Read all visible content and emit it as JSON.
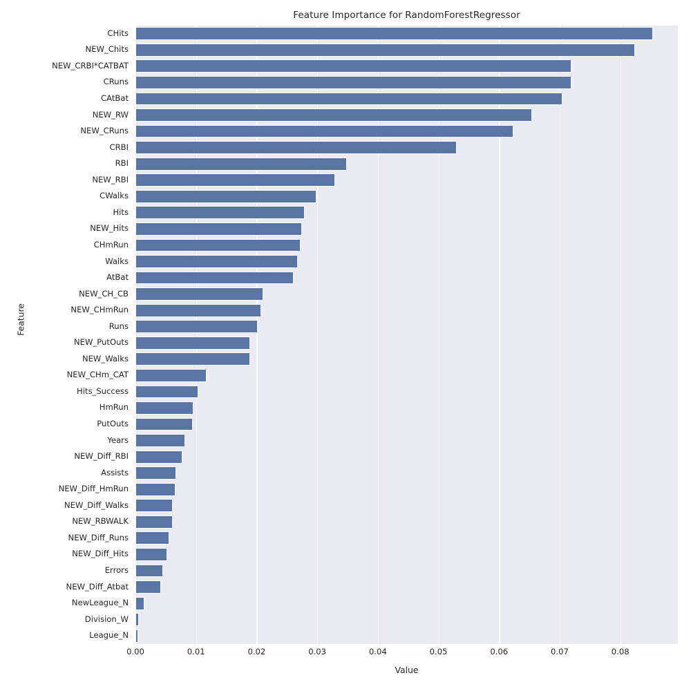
{
  "chart_data": {
    "type": "bar",
    "orientation": "horizontal",
    "title": "Feature Importance for RandomForestRegressor",
    "xlabel": "Value",
    "ylabel": "Feature",
    "xlim": [
      0.0,
      0.0895
    ],
    "xticks": [
      0.0,
      0.01,
      0.02,
      0.03,
      0.04,
      0.05,
      0.06,
      0.07,
      0.08
    ],
    "xticklabels": [
      "0.00",
      "0.01",
      "0.02",
      "0.03",
      "0.04",
      "0.05",
      "0.06",
      "0.07",
      "0.08"
    ],
    "grid": true,
    "legend": null,
    "bar_color": "#5875a3",
    "plot_background": "#eaeaf2",
    "figure_background": "#ffffff",
    "grid_color": "#ffffff",
    "categories": [
      "CHits",
      "NEW_Chits",
      "NEW_CRBI*CATBAT",
      "CRuns",
      "CAtBat",
      "NEW_RW",
      "NEW_CRuns",
      "CRBI",
      "RBI",
      "NEW_RBI",
      "CWalks",
      "Hits",
      "NEW_Hits",
      "CHmRun",
      "Walks",
      "AtBat",
      "NEW_CH_CB",
      "NEW_CHmRun",
      "Runs",
      "NEW_PutOuts",
      "NEW_Walks",
      "NEW_CHm_CAT",
      "Hits_Success",
      "HmRun",
      "PutOuts",
      "Years",
      "NEW_Diff_RBI",
      "Assists",
      "NEW_Diff_HmRun",
      "NEW_Diff_Walks",
      "NEW_RBWALK",
      "NEW_Diff_Runs",
      "NEW_Diff_Hits",
      "Errors",
      "NEW_Diff_Atbat",
      "NewLeague_N",
      "Division_W",
      "League_N"
    ],
    "values": [
      0.0854,
      0.0824,
      0.0719,
      0.0719,
      0.0705,
      0.0654,
      0.0624,
      0.053,
      0.0349,
      0.0329,
      0.0299,
      0.0279,
      0.0275,
      0.0272,
      0.0268,
      0.0261,
      0.0211,
      0.0207,
      0.0202,
      0.0189,
      0.0189,
      0.0117,
      0.0104,
      0.0096,
      0.0095,
      0.0082,
      0.0078,
      0.0067,
      0.0066,
      0.0062,
      0.0062,
      0.0056,
      0.0052,
      0.0046,
      0.0042,
      0.0015,
      0.0006,
      0.0004
    ]
  }
}
